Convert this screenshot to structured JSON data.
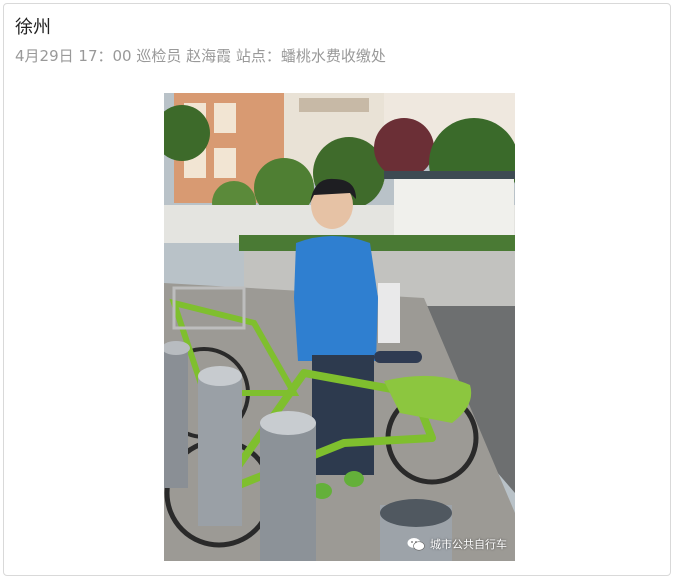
{
  "post": {
    "title": "徐州",
    "meta_line": "4月29日  17：00   巡检员  赵海霞     站点：蟠桃水费收缴处"
  },
  "photo": {
    "watermark_text": "城市公共自行车",
    "watermark_icon": "wechat-icon"
  }
}
